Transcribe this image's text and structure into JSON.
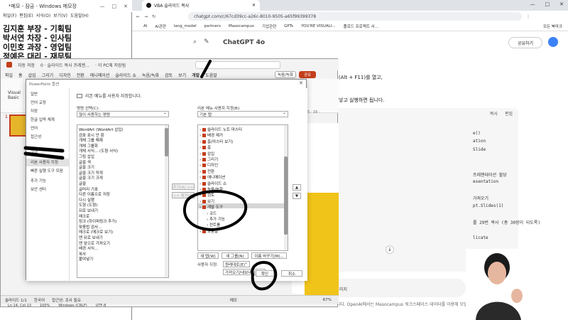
{
  "notepad": {
    "title": "*메모 - 잠금 - Windows 메모장",
    "controls": [
      "—",
      "□",
      "✕"
    ],
    "menu": [
      "파일(F)",
      "편집(E)",
      "서식(O)",
      "보기(V)",
      "도움말(H)"
    ],
    "lines": [
      "김지훈 부장 - 기획팀",
      "박서연 차장 - 인사팀",
      "이민호 과장 - 영업팀",
      "정예은 대리 - 재무팀"
    ]
  },
  "browser": {
    "tab_title": "VBA 슬라이드 복사",
    "window_controls": [
      "—",
      "□",
      "✕"
    ],
    "url": "chatgpt.com/c/67cd39cc-a26c-8010-9505-a65f99399378",
    "bookmarks": [
      "AI",
      "AI관련",
      "lang_model",
      "partners",
      "Masocampus",
      "기업관련",
      "GPTs",
      "YOU'RE VISUALI...",
      "폴로드 프로젝트 서..."
    ],
    "bookmarks_all": "모든 북마크",
    "model": "ChatGPT 4o",
    "share": "공유하기",
    "chat_lines": [
      "집기(Alt + F11)를 열고,",
      "붙여넣고 실행하면 됩니다."
    ],
    "code_bar": [
      "복사",
      "편집"
    ],
    "code_lines": [
      "e()",
      "ation",
      "Slide",
      "",
      "",
      "프레젠테이션 할당",
      "esentation",
      "",
      "가져오기",
      "pt.Slides(1)",
      "",
      "를 29번 복사 (총 30장이 되도록)",
      "",
      "licate"
    ],
    "pills": [
      "...",
      "미지"
    ],
    "down_arrow": "↓",
    "footer_note": "ChatGPT는 실수를 할 수 있습니다. OpenAI에서는 Masocampus 워크스페이스 데이터를 이용해 모델을"
  },
  "ppt": {
    "title_items": [
      "자동 저장",
      "0 · 슬라이드 복사 프레젠…",
      "· 이 PC에 저장됨"
    ],
    "ribbon": [
      "파일",
      "홈",
      "삽입",
      "그리기",
      "디자인",
      "전환",
      "애니메이션",
      "슬라이드 쇼",
      "녹음/녹화",
      "검토",
      "보기",
      "개발",
      "도움말"
    ],
    "record_btn": "녹음/녹화",
    "share_btn": "공유",
    "vb_label": [
      "Visual",
      "Basic"
    ],
    "slide_num": "1",
    "status": [
      "슬라이드 1/1",
      "한국어",
      "접근성: 조사 필요"
    ],
    "zoom": "67%",
    "ruler_label": "5 · 16 ·",
    "edit_status": [
      "Ln 14, Col 13",
      "100%",
      "Windows (CRLF)",
      "UTF-8"
    ],
    "notes": "메모"
  },
  "options": {
    "title": "PowerPoint 옵션",
    "nav": [
      "일반",
      "언어 교정",
      "저장",
      "한글 입력 체계",
      "언어",
      "접근성",
      "고급",
      "리본 사용자 지정",
      "빠른 실행 도구 모음",
      "추가 기능",
      "보안 센터"
    ],
    "selected_nav": "리본 사용자 지정",
    "heading": "리본 메뉴를 사용자 지정합니다.",
    "commands_label": "명령 선택(C):",
    "commands_value": "많이 사용하는 명령",
    "ribbon_label": "리본 메뉴 사용자 지정(B):",
    "ribbon_value": "기본 탭",
    "commands": [
      "WordArt (WordArt 삽입)",
      "검호 표시 안 함",
      "개체 그룹 해제",
      "개체 그룹화",
      "개체 서식... (도형 서식)",
      "그림 삽입",
      "글꼴 색",
      "글꼴 크기",
      "글꼴 크기 작게",
      "글꼴 크기 크게",
      "글꼴",
      "글머리 기호",
      "다른 이름으로 저장",
      "다시 실행",
      "도형 (도형)",
      "뒤로 보내기",
      "매크로",
      "링크 (하이퍼링크 추가)",
      "맞춤법 검사...",
      "매크로 (매크로 보기)",
      "맨 뒤로 보내기",
      "맨 앞으로 가져오기",
      "배경 서식...",
      "복사",
      "붙여넣기"
    ],
    "tabs": [
      "슬라이드 노트 마스터",
      "배경 제거",
      "홈(마스터 보기)",
      "홈",
      "삽입",
      "그리기",
      "디자인",
      "전환",
      "애니메이션",
      "슬라이드 쇼",
      "녹음/녹화",
      "검토",
      "보기",
      "개발 도구",
      "코드",
      "추가 기능",
      "컨트롤",
      "도움말"
    ],
    "add_btn": "추가(A) >>",
    "remove_btn": "<< 제거(R)",
    "new_tab_btn": "새 탭(W)",
    "new_group_btn": "새 그룹(N)",
    "rename_btn": "이름 바꾸기(M)...",
    "custom_label": "사용자 지정:",
    "reset_btn": "원래대로(E)",
    "import_btn": "가져오기/내보내기(P)",
    "ok_btn": "확인",
    "cancel_btn": "취소",
    "up_btn": "▲",
    "down_btn": "▼"
  },
  "colors": {
    "ppt_accent": "#c43e1c",
    "slide_gold": "#f0c419",
    "link_blue": "#3b82f6"
  }
}
